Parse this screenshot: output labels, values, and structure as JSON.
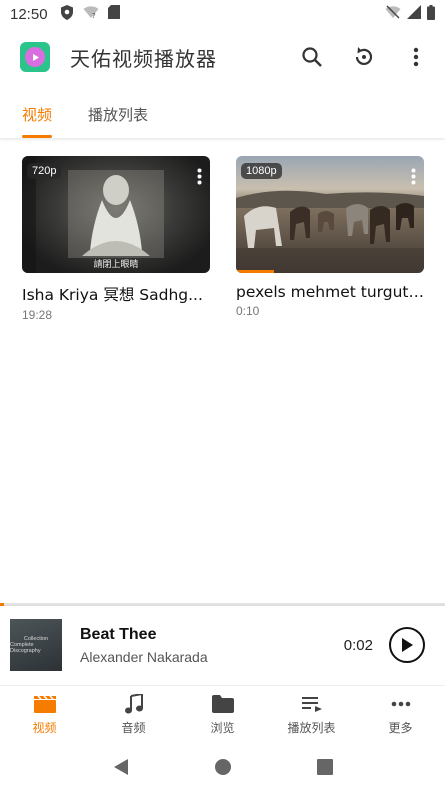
{
  "status_bar": {
    "time": "12:50",
    "left_icons": [
      "shield-icon",
      "wifi-question-icon",
      "sd-card-icon"
    ],
    "right_icons": [
      "wifi-off-icon",
      "cell-signal-icon",
      "battery-icon"
    ]
  },
  "app_bar": {
    "title": "天佑视频播放器",
    "actions": [
      "search-icon",
      "refresh-icon",
      "more-vert-icon"
    ]
  },
  "tabs": [
    {
      "label": "视频",
      "active": true
    },
    {
      "label": "播放列表",
      "active": false
    }
  ],
  "videos": [
    {
      "resolution": "720p",
      "title": "Isha Kriya 冥想 Sadhg...",
      "duration": "19:28",
      "caption": "請閉上眼睛",
      "progress": 0.0
    },
    {
      "resolution": "1080p",
      "title": "pexels mehmet turgut ...",
      "duration": "0:10",
      "caption": "",
      "progress": 0.2
    }
  ],
  "mini_player": {
    "title": "Beat Thee",
    "artist": "Alexander Nakarada",
    "time": "0:02",
    "progress": 0.01,
    "album_art_text_1": "Collection",
    "album_art_text_2": "Complete Discography"
  },
  "bottom_nav": [
    {
      "label": "视频",
      "icon": "movie-clapper-icon",
      "active": true
    },
    {
      "label": "音频",
      "icon": "music-note-icon",
      "active": false
    },
    {
      "label": "浏览",
      "icon": "folder-icon",
      "active": false
    },
    {
      "label": "播放列表",
      "icon": "playlist-icon",
      "active": false
    },
    {
      "label": "更多",
      "icon": "more-horiz-icon",
      "active": false
    }
  ],
  "colors": {
    "accent": "#f57c00",
    "logo_bg": "#2bc48a",
    "logo_inner": "#d96ee0"
  }
}
